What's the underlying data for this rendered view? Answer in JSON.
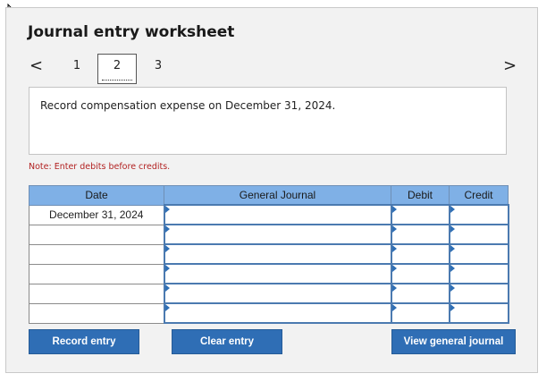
{
  "title": "Journal entry worksheet",
  "pager": {
    "prev": "<",
    "next": ">",
    "pages": [
      "1",
      "2",
      "3"
    ],
    "active": "2"
  },
  "instruction": "Record compensation expense on December 31, 2024.",
  "note": "Note: Enter debits before credits.",
  "table": {
    "headers": {
      "date": "Date",
      "general_journal": "General Journal",
      "debit": "Debit",
      "credit": "Credit"
    },
    "rows": [
      {
        "date": "December 31, 2024",
        "account": "",
        "debit": "",
        "credit": ""
      },
      {
        "date": "",
        "account": "",
        "debit": "",
        "credit": ""
      },
      {
        "date": "",
        "account": "",
        "debit": "",
        "credit": ""
      },
      {
        "date": "",
        "account": "",
        "debit": "",
        "credit": ""
      },
      {
        "date": "",
        "account": "",
        "debit": "",
        "credit": ""
      },
      {
        "date": "",
        "account": "",
        "debit": "",
        "credit": ""
      }
    ]
  },
  "buttons": {
    "record": "Record entry",
    "clear": "Clear entry",
    "view": "View general journal"
  },
  "icons": {
    "cursor": "mouse-pointer-icon"
  },
  "colors": {
    "button": "#2f6eb5",
    "header": "#7fb0e6",
    "note": "#b22222"
  }
}
